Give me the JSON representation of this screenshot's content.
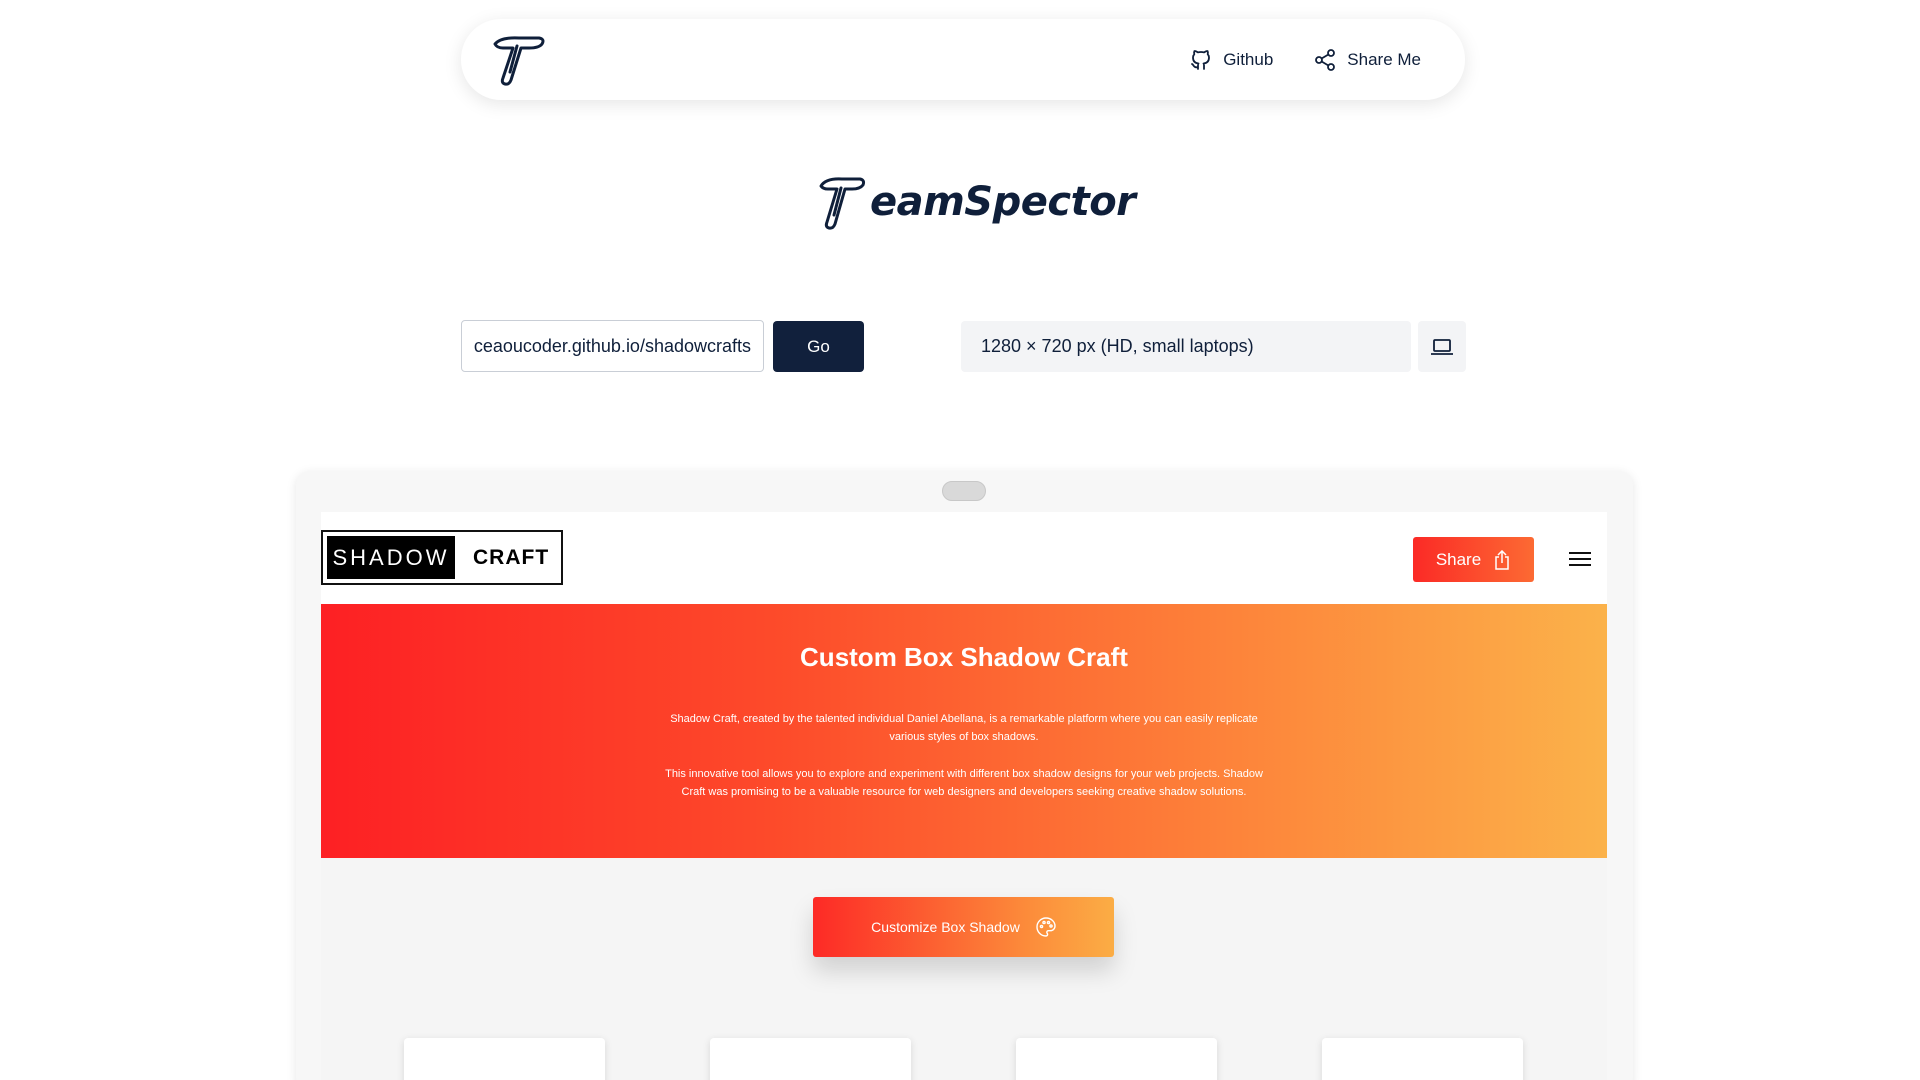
{
  "nav": {
    "logo_icon": "teamspector-logo-icon",
    "github_label": "Github",
    "share_label": "Share Me"
  },
  "brand": {
    "wordmark": "eamSpector"
  },
  "toolbar": {
    "url_value": "https://ibrahimabdulaziz.ceaoucoder.github.io/shadowcrafts/",
    "url_visible": "ɔucoder.github.io/shadowcrafts/",
    "go_label": "Go",
    "device_value": "1280 × 720 px (HD, small laptops)",
    "device_icon": "laptop-icon"
  },
  "preview": {
    "site": {
      "logo_dark": "SHADOW",
      "logo_light": "CRAFT",
      "share_label": "Share",
      "hero_title": "Custom Box Shadow Craft",
      "hero_p1": "Shadow Craft, created by the talented individual Daniel Abellana, is a remarkable platform where you can easily replicate various styles of box shadows.",
      "hero_p2": "This innovative tool allows you to explore and experiment with different box shadow designs for your web projects. Shadow Craft was promising to be a valuable resource for web designers and developers seeking creative shadow solutions.",
      "customize_label": "Customize Box Shadow"
    }
  },
  "colors": {
    "navy": "#0f1f3a",
    "hero_start": "#fd2024",
    "hero_end": "#fbb24a"
  }
}
